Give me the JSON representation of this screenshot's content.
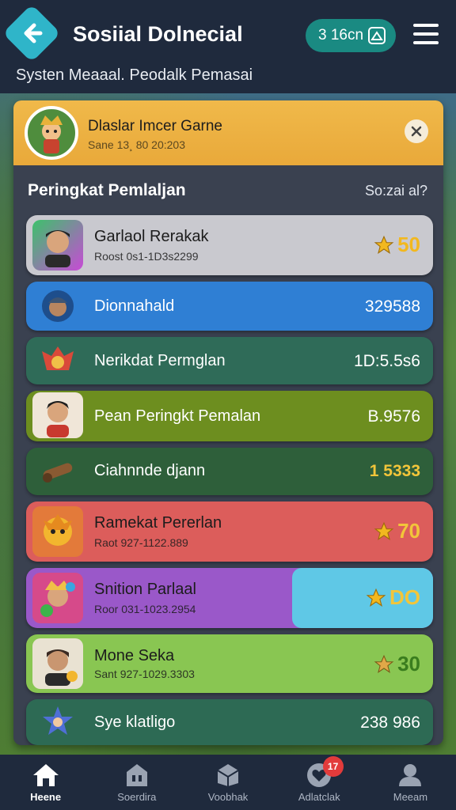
{
  "header": {
    "title": "Sosiial Dolnecial",
    "pill_text": "3 16cn",
    "subtitle": "Systen Meaaal. Peodalk Pemasai"
  },
  "banner": {
    "title": "Dlaslar Imcer Garne",
    "subtitle": "Sane 13¸ 80 20:203"
  },
  "leaderboard": {
    "title": "Peringkat Pemlaljan",
    "meta": "So:zai al?",
    "rows": [
      {
        "name": "Garlaol Rerakak",
        "meta": "Roost 0s1-1D3s2299",
        "score": "50",
        "bg": "#c9c9cf",
        "text": "#1c1c1c"
      },
      {
        "name": "Dionnahald",
        "meta": "",
        "score": "329588",
        "bg": "#2f7fd4",
        "text": "#ffffff"
      },
      {
        "name": "Nerikdat Permglan",
        "meta": "",
        "score": "1D:5.5s6",
        "bg": "#2f6b58",
        "text": "#ffffff"
      },
      {
        "name": "Pean Peringkt Pemalan",
        "meta": "",
        "score": "B.9576",
        "bg": "#6d8e1f",
        "text": "#ffffff"
      },
      {
        "name": "Ciahnnde djann",
        "meta": "",
        "score": "1  5333",
        "bg": "#2e5f3a",
        "text": "#ffffff"
      },
      {
        "name": "Ramekat Pererlan",
        "meta": "Raot 927-1122.889",
        "score": "70",
        "bg": "#dc5d5b",
        "text": "#1c1c1c"
      },
      {
        "name": "Snition Parlaal",
        "meta": "Roor 031-1023.2954",
        "score": "DO",
        "bg": "#9a58c9",
        "text": "#1c1c1c"
      },
      {
        "name": "Mone Seka",
        "meta": "Sant 927-1029.3303",
        "score": "30",
        "bg": "#89c652",
        "text": "#1c1c1c"
      },
      {
        "name": "Sye klatligo",
        "meta": "",
        "score": "238 986",
        "bg": "#2d6a54",
        "text": "#ffffff"
      }
    ]
  },
  "nav": {
    "items": [
      {
        "label": "Heene"
      },
      {
        "label": "Soerdira"
      },
      {
        "label": "Voobhak"
      },
      {
        "label": "Adlatclak"
      },
      {
        "label": "Meeam"
      }
    ],
    "badge": "17"
  }
}
